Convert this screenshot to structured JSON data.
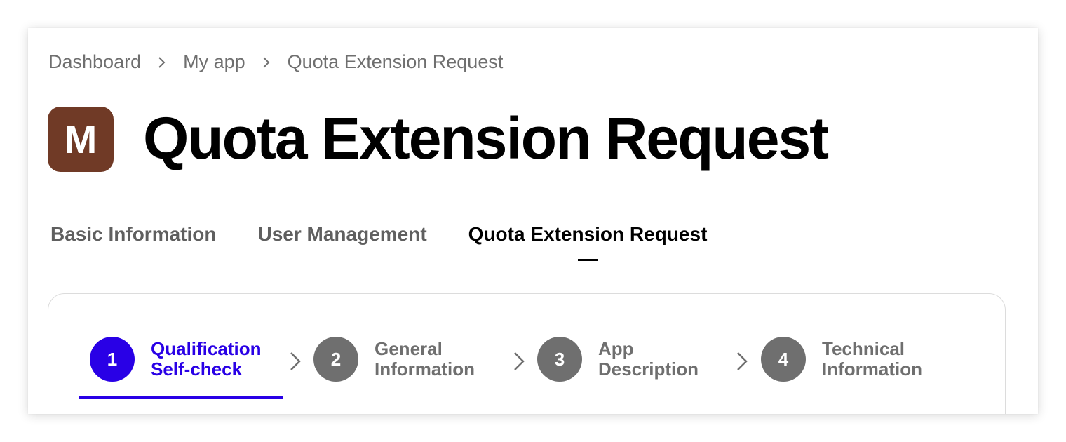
{
  "breadcrumb": {
    "items": [
      "Dashboard",
      "My app",
      "Quota Extension Request"
    ],
    "separator_icon": "chevron-right-icon"
  },
  "app": {
    "avatar_letter": "M",
    "avatar_color": "#703a26"
  },
  "page_title": "Quota Extension Request",
  "tabs": [
    {
      "label": "Basic Information",
      "active": false
    },
    {
      "label": "User Management",
      "active": false
    },
    {
      "label": "Quota Extension Request",
      "active": true
    }
  ],
  "steps": [
    {
      "number": "1",
      "line1": "Qualification",
      "line2": "Self-check",
      "active": true
    },
    {
      "number": "2",
      "line1": "General",
      "line2": "Information",
      "active": false
    },
    {
      "number": "3",
      "line1": "App",
      "line2": "Description",
      "active": false
    },
    {
      "number": "4",
      "line1": "Technical",
      "line2": "Information",
      "active": false
    }
  ],
  "colors": {
    "accent": "#2900e6",
    "inactive_step": "#6f6f6f",
    "breadcrumb_text": "#6f6f6f",
    "tab_inactive": "#5f5f5f",
    "title": "#000000"
  }
}
